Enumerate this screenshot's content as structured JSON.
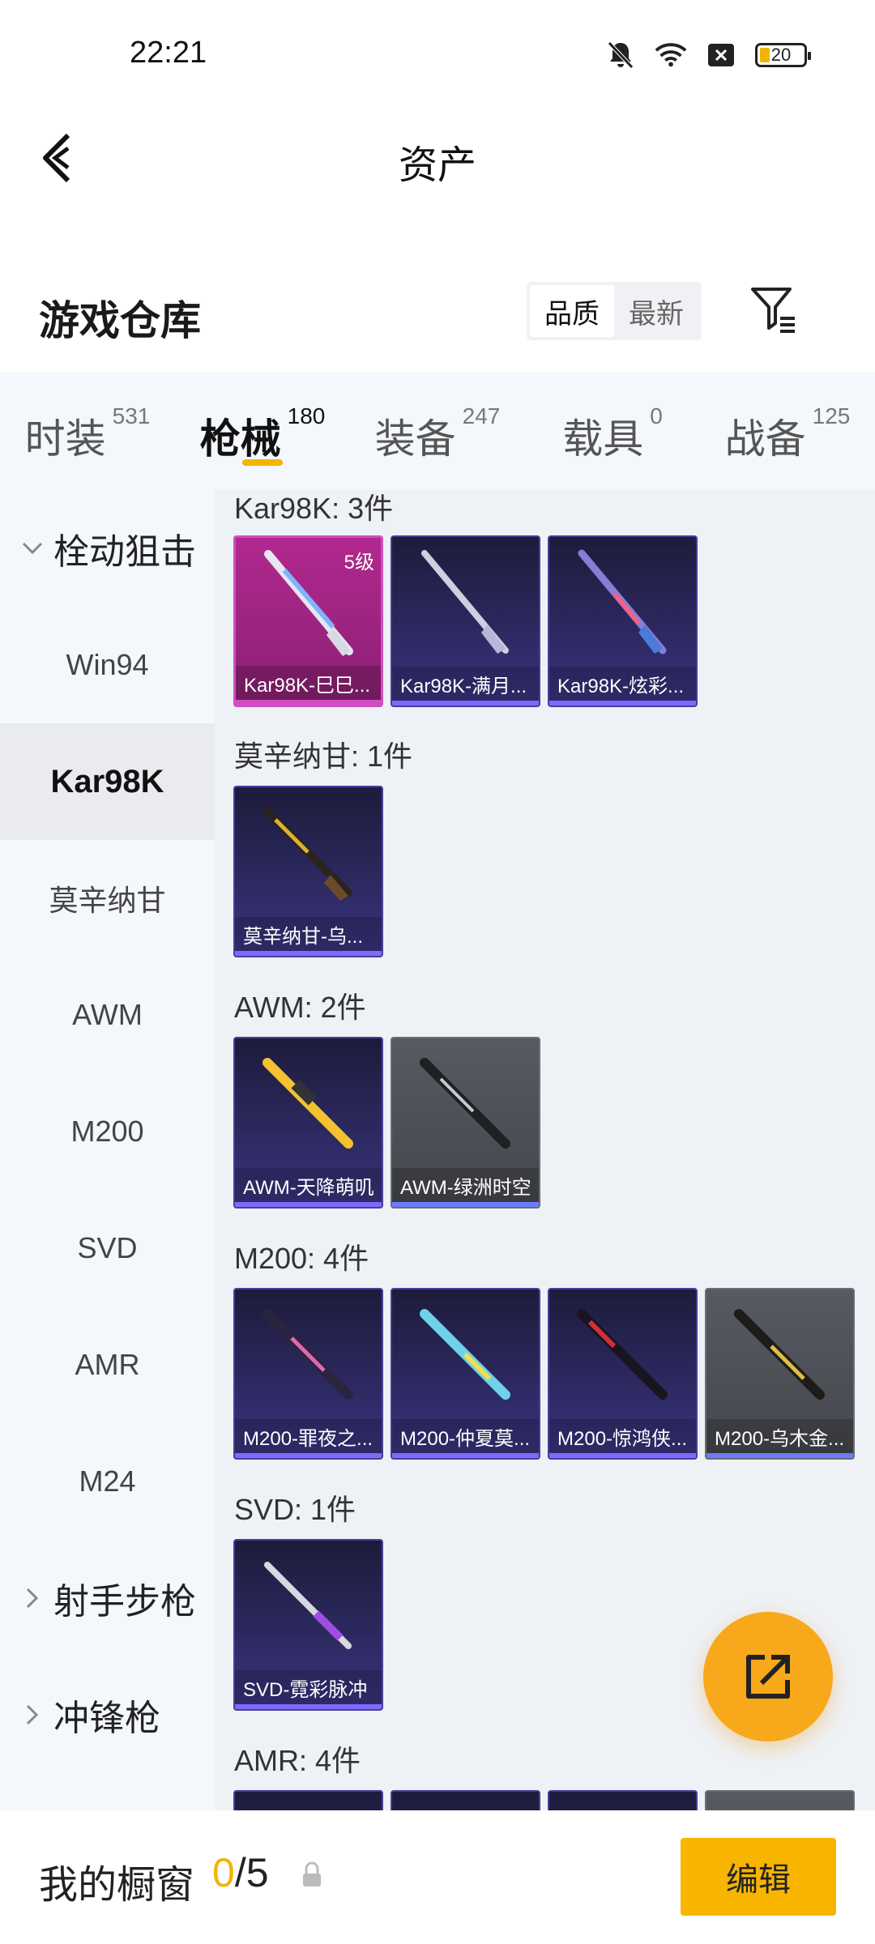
{
  "status": {
    "time": "22:21",
    "battery": "20"
  },
  "header": {
    "title": "资产"
  },
  "warehouse": {
    "title": "游戏仓库",
    "sort_options": [
      "品质",
      "最新"
    ]
  },
  "tabs": [
    {
      "label": "时装",
      "count": "531"
    },
    {
      "label": "枪械",
      "count": "180"
    },
    {
      "label": "装备",
      "count": "247"
    },
    {
      "label": "载具",
      "count": "0"
    },
    {
      "label": "战备",
      "count": "125"
    }
  ],
  "sidebar": {
    "group_sniper": "栓动狙击",
    "items": [
      "Win94",
      "Kar98K",
      "莫辛纳甘",
      "AWM",
      "M200",
      "SVD",
      "AMR",
      "M24"
    ],
    "group_marksman": "射手步枪",
    "group_smg": "冲锋枪"
  },
  "sections": {
    "kar98k": "Kar98K: 3件",
    "mosin": "莫辛纳甘: 1件",
    "awm": "AWM: 2件",
    "m200": "M200: 4件",
    "svd": "SVD: 1件",
    "amr": "AMR: 4件"
  },
  "cards": {
    "kar1": {
      "name": "Kar98K-巳巳...",
      "level": "5级"
    },
    "kar2": {
      "name": "Kar98K-满月..."
    },
    "kar3": {
      "name": "Kar98K-炫彩..."
    },
    "mosin1": {
      "name": "莫辛纳甘-乌..."
    },
    "awm1": {
      "name": "AWM-天降萌叽"
    },
    "awm2": {
      "name": "AWM-绿洲时空"
    },
    "m2001": {
      "name": "M200-罪夜之..."
    },
    "m2002": {
      "name": "M200-仲夏莫..."
    },
    "m2003": {
      "name": "M200-惊鸿侠..."
    },
    "m2004": {
      "name": "M200-乌木金..."
    },
    "svd1": {
      "name": "SVD-霓彩脉冲"
    }
  },
  "bottom": {
    "label": "我的橱窗",
    "used": "0",
    "total": "/5",
    "edit": "编辑"
  },
  "colors": {
    "accent": "#f4b400",
    "fab": "#f7a81b"
  }
}
